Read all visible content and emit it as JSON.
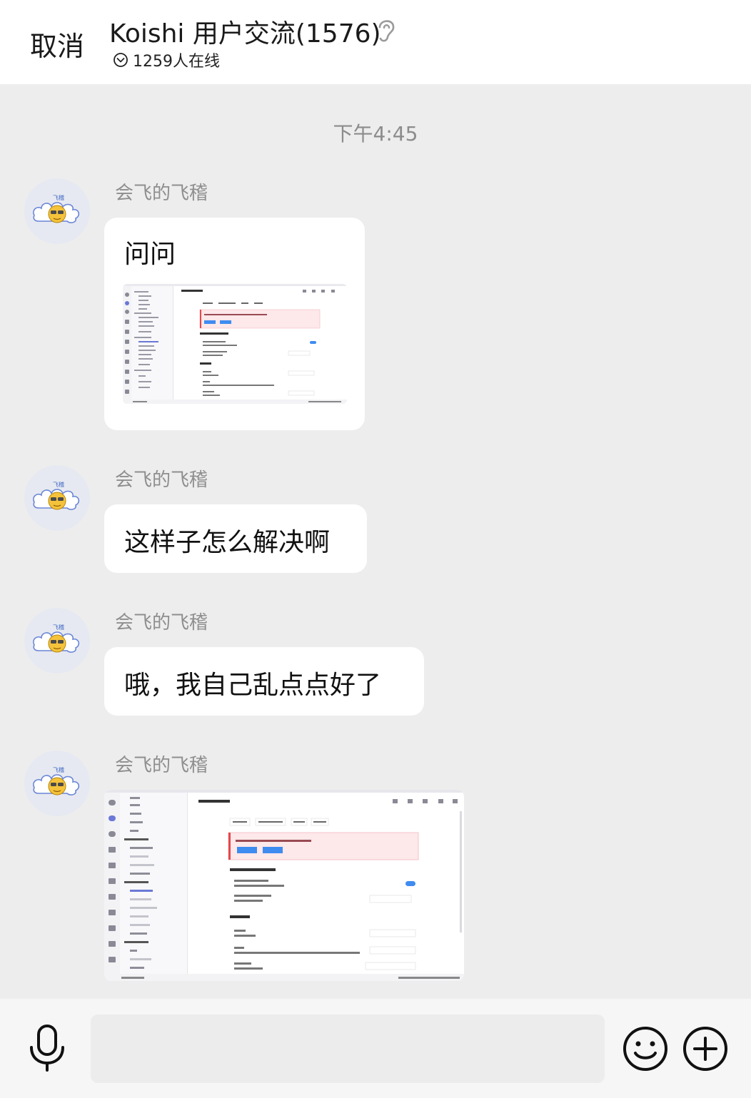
{
  "header": {
    "cancel_label": "取消",
    "title": "Koishi 用户交流(1576)",
    "online_text": "1259人在线"
  },
  "timestamp": "下午4:45",
  "messages": [
    {
      "sender": "会飞的飞稽",
      "text": "问问",
      "has_image": true
    },
    {
      "sender": "会飞的飞稽",
      "text": "这样子怎么解决啊",
      "has_image": false
    },
    {
      "sender": "会飞的飞稽",
      "text": "哦，我自己乱点点好了",
      "has_image": false
    },
    {
      "sender": "会飞的飞稽",
      "text": "",
      "has_image": true
    }
  ],
  "screenshot_thumb": {
    "tab_title": "adapter-onebot",
    "buttons": [
      "启用配置",
      "运行版本 5.7.0",
      "停用配置",
      "移除插件"
    ],
    "error_banner": "该插件在运行时发生错误，请检查配置后再试",
    "banner_buttons": [
      "重新加载",
      "重新配置"
    ],
    "section1": "go-cqhttp 基础设置",
    "fields1": [
      "gocqhttp.enabled",
      "gocqhttp.password"
    ],
    "section2": "基础设置",
    "fields2": [
      "selfId",
      "token",
      "protocol"
    ],
    "sidebar_groups": [
      "分组: storage",
      "分组: adapter",
      "分组: develop"
    ],
    "sidebar_items": [
      "insight",
      "market",
      "sandbox",
      "status",
      "database-sqlite",
      "assets-local",
      "adapter-onebot",
      "gocqhttp",
      "help",
      "koishi"
    ],
    "footer_left": "Koishi 4.11.0"
  },
  "footer": {
    "input_placeholder": ""
  },
  "colors": {
    "background": "#ededed",
    "bubble": "#ffffff",
    "header": "#ffffff"
  }
}
